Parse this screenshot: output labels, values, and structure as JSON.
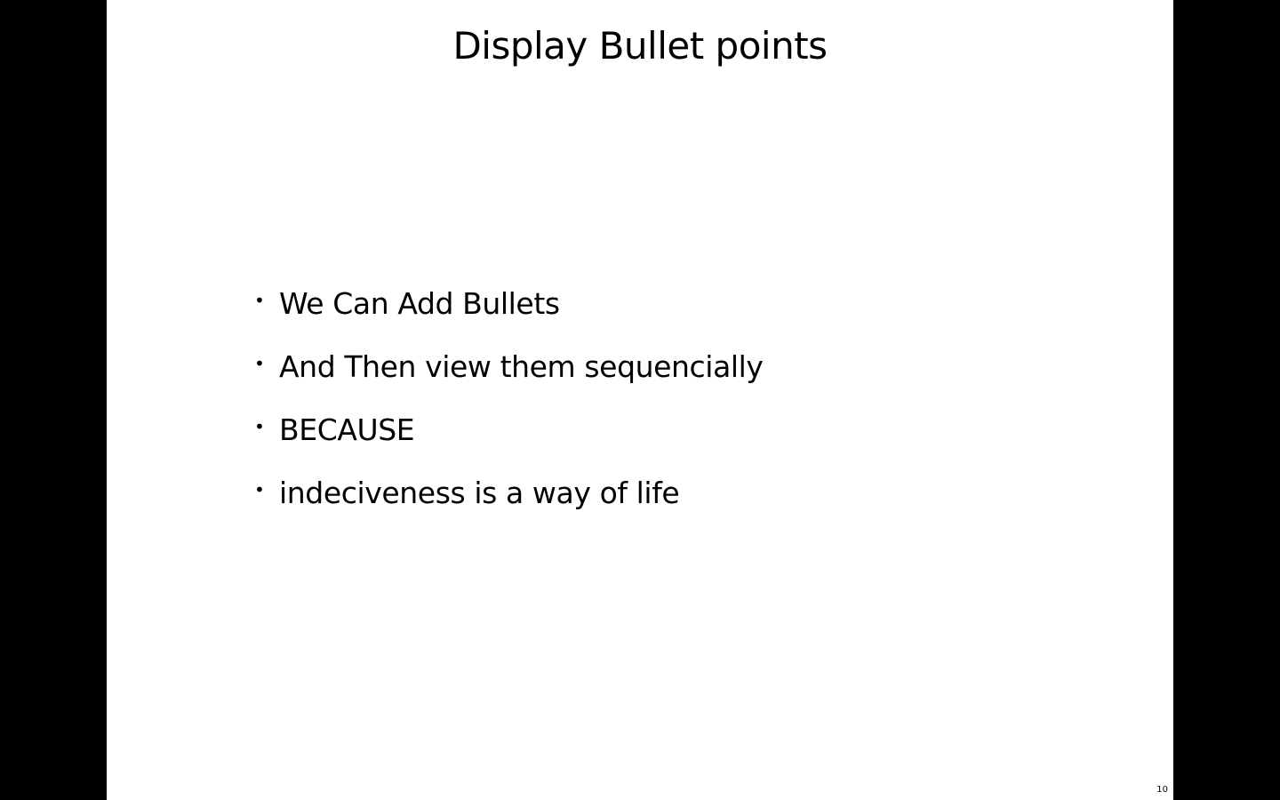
{
  "slide": {
    "title": "Display Bullet points",
    "bullets": [
      "We Can Add Bullets",
      "And Then view them sequencially",
      "BECAUSE",
      "indeciveness is a way of life"
    ],
    "bullet_symbol": "•",
    "page_number": "10"
  },
  "colors": {
    "background": "#000000",
    "slide": "#ffffff",
    "text": "#000000"
  }
}
